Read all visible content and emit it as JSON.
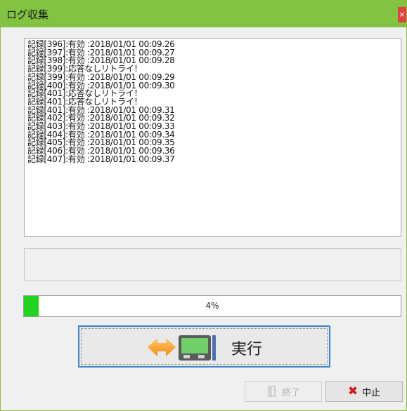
{
  "window": {
    "title": "ログ収集",
    "close_symbol": "×"
  },
  "log": {
    "lines": [
      "記録[396]:有効 :2018/01/01 00:09.26",
      "記録[397]:有効 :2018/01/01 00:09.27",
      "記録[398]:有効 :2018/01/01 00:09.28",
      "記録[399]:応答なしリトライ！",
      "記録[399]:有効 :2018/01/01 00:09.29",
      "記録[400]:有効 :2018/01/01 00:09.30",
      "記録[401]:応答なしリトライ！",
      "記録[401]:応答なしリトライ！",
      "記録[401]:有効 :2018/01/01 00:09.31",
      "記録[402]:有効 :2018/01/01 00:09.32",
      "記録[403]:有効 :2018/01/01 00:09.33",
      "記録[404]:有効 :2018/01/01 00:09.34",
      "記録[405]:有効 :2018/01/01 00:09.35",
      "記録[406]:有効 :2018/01/01 00:09.36",
      "記録[407]:有効 :2018/01/01 00:09.37"
    ]
  },
  "status": {
    "text": ""
  },
  "progress": {
    "value": 0.04,
    "label": "4%",
    "color": "#1fd51f"
  },
  "buttons": {
    "run_label": "実行",
    "run_icon": "transfer-device-icon",
    "end_label": "終了",
    "end_icon": "exit-door-icon",
    "stop_label": "中止",
    "stop_icon": "x-icon"
  }
}
